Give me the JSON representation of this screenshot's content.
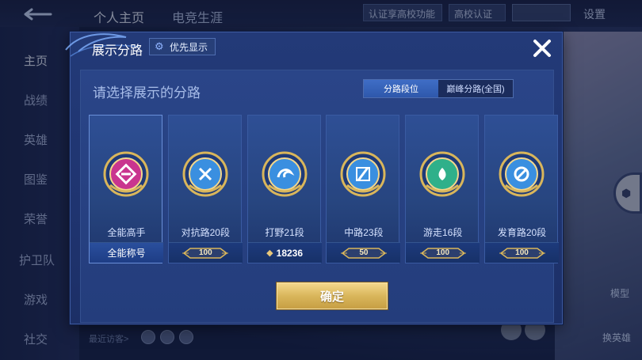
{
  "background": {
    "tabs": [
      "个人主页",
      "电竞生涯"
    ],
    "top_buttons": {
      "verify": "认证享高校功能",
      "campus": "高校认证",
      "settings": "设置"
    },
    "side_nav": [
      "主页",
      "战绩",
      "英雄",
      "图鉴",
      "荣誉",
      "护卫队",
      "游戏",
      "社交"
    ],
    "side_active": "主页",
    "right_labels": {
      "mold": "模型",
      "swap": "换英雄"
    },
    "visitors_label": "最近访客>"
  },
  "dialog": {
    "title": "展示分路",
    "priority_button": "优先显示",
    "prompt": "请选择展示的分路",
    "segment": {
      "options": [
        "分路段位",
        "巅峰分路(全国)"
      ],
      "selected": 0
    },
    "cards": [
      {
        "name": "全能高手",
        "foot_type": "text",
        "foot": "全能称号",
        "selected": true,
        "emblem": "all-round-emblem-icon",
        "color": "#c9358f"
      },
      {
        "name": "对抗路20段",
        "foot_type": "badge",
        "foot": "100",
        "selected": false,
        "emblem": "clash-lane-emblem-icon",
        "color": "#3a8fe0"
      },
      {
        "name": "打野21段",
        "foot_type": "peak",
        "foot": "18236",
        "selected": false,
        "emblem": "jungle-emblem-icon",
        "color": "#3a8fe0"
      },
      {
        "name": "中路23段",
        "foot_type": "badge",
        "foot": "50",
        "selected": false,
        "emblem": "mid-lane-emblem-icon",
        "color": "#3a8fe0"
      },
      {
        "name": "游走16段",
        "foot_type": "badge",
        "foot": "100",
        "selected": false,
        "emblem": "roam-emblem-icon",
        "color": "#2fb08a"
      },
      {
        "name": "发育路20段",
        "foot_type": "badge",
        "foot": "100",
        "selected": false,
        "emblem": "farm-lane-emblem-icon",
        "color": "#3a8fe0"
      }
    ],
    "confirm": "确定"
  },
  "colors": {
    "gold": "#d9b65b",
    "accent": "#3f6dc6",
    "panel": "#233a78"
  }
}
